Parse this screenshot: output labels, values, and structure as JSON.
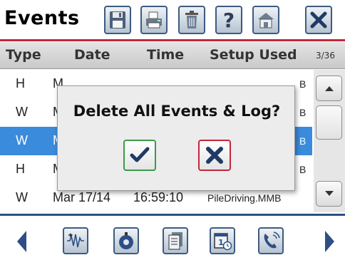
{
  "header": {
    "title": "Events",
    "toolbar": [
      {
        "name": "save-button",
        "icon": "floppy-disk-icon"
      },
      {
        "name": "print-button",
        "icon": "printer-icon"
      },
      {
        "name": "delete-button",
        "icon": "trash-icon"
      },
      {
        "name": "help-button",
        "icon": "question-mark-icon"
      },
      {
        "name": "home-button",
        "icon": "house-icon"
      },
      {
        "name": "close-button",
        "icon": "close-x-icon"
      }
    ]
  },
  "columns": {
    "type": "Type",
    "date": "Date",
    "time": "Time",
    "setup": "Setup Used",
    "count": "3/36"
  },
  "rows": [
    {
      "type": "H",
      "date": "M",
      "time": "",
      "setup": "B",
      "selected": false
    },
    {
      "type": "W",
      "date": "M",
      "time": "",
      "setup": "B",
      "selected": false
    },
    {
      "type": "W",
      "date": "M",
      "time": "",
      "setup": "B",
      "selected": true
    },
    {
      "type": "H",
      "date": "M",
      "time": "",
      "setup": "B",
      "selected": false
    },
    {
      "type": "W",
      "date": "Mar 17/14",
      "time": "16:59:10",
      "setup": "PileDriving.MMB",
      "selected": false
    }
  ],
  "dialog": {
    "message": "Delete All Events & Log?",
    "confirm_icon": "checkmark-icon",
    "cancel_icon": "close-x-icon"
  },
  "footer": {
    "buttons": [
      {
        "name": "waveform-button",
        "icon": "waveform-icon"
      },
      {
        "name": "sensor-button",
        "icon": "geophone-icon"
      },
      {
        "name": "documents-button",
        "icon": "documents-icon"
      },
      {
        "name": "calendar-button",
        "icon": "calendar-clock-icon"
      },
      {
        "name": "phone-button",
        "icon": "phone-icon"
      }
    ]
  },
  "colors": {
    "accent_red": "#c3273a",
    "accent_blue": "#2d4f86",
    "selection": "#3a8bdc",
    "confirm_green": "#3a9a4a"
  }
}
